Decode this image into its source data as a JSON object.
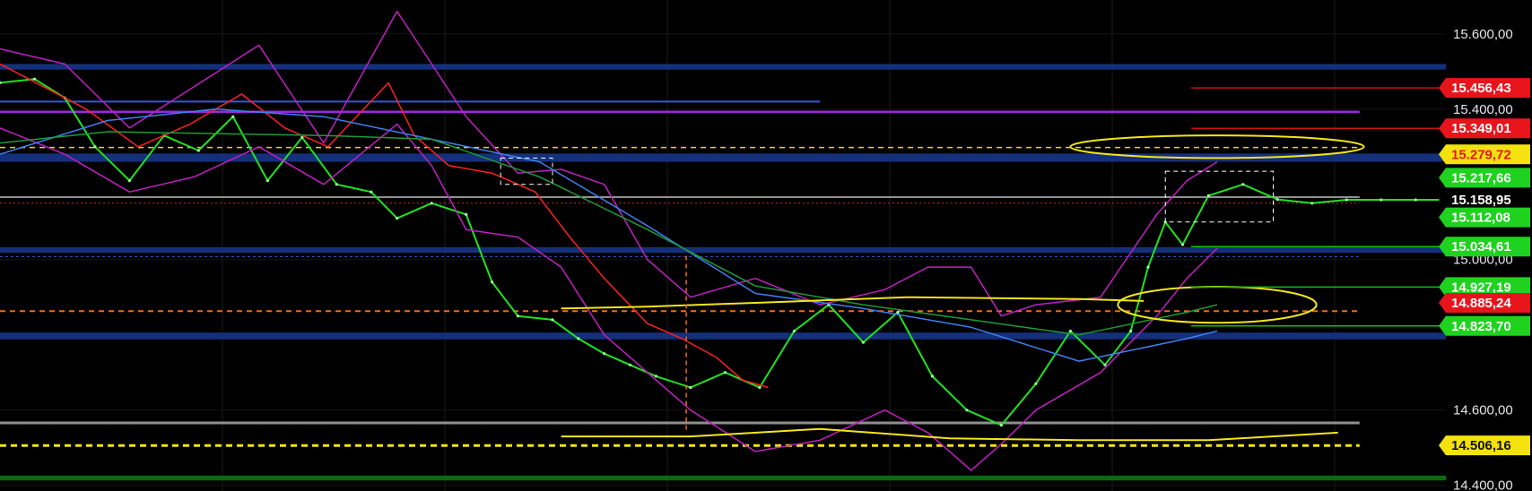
{
  "chart_data": {
    "type": "line",
    "ylim": [
      14385,
      15690
    ],
    "x_range": [
      0,
      335
    ],
    "grid": true,
    "y_axis_labels": [
      {
        "value": 15600,
        "text": "15.600,00"
      },
      {
        "value": 15400,
        "text": "15.400,00"
      },
      {
        "value": 15000,
        "text": "15.000,00"
      },
      {
        "value": 14600,
        "text": "14.600,00"
      },
      {
        "value": 14400,
        "text": "14.400,00"
      }
    ],
    "price_tags": [
      {
        "value": 15456.43,
        "text": "15.456,43",
        "bg": "#e8141c",
        "fg": "#ffffff",
        "line": "#d01010",
        "line_from": 276
      },
      {
        "value": 15349.01,
        "text": "15.349,01",
        "bg": "#e8141c",
        "fg": "#ffffff",
        "line": "#d01010",
        "line_from": 276
      },
      {
        "value": 15279.72,
        "text": "15.279,72",
        "bg": "#f4e20e",
        "fg": "#e8141c",
        "line": null,
        "line_from": null
      },
      {
        "value": 15217.66,
        "text": "15.217,66",
        "bg": "#1fd21f",
        "fg": "#ffffff",
        "line": null,
        "line_from": null
      },
      {
        "value": 15158.95,
        "text": "15.158,95",
        "bg": "#000000",
        "fg": "#ffffff",
        "line": null,
        "line_from": null
      },
      {
        "value": 15112.08,
        "text": "15.112,08",
        "bg": "#1fd21f",
        "fg": "#ffffff",
        "line": null,
        "line_from": null
      },
      {
        "value": 15034.61,
        "text": "15.034,61",
        "bg": "#1fd21f",
        "fg": "#ffffff",
        "line": "#10c010",
        "line_from": 276
      },
      {
        "value": 14927.19,
        "text": "14.927,19",
        "bg": "#1fd21f",
        "fg": "#ffffff",
        "line": "#10c010",
        "line_from": 276
      },
      {
        "value": 14885.24,
        "text": "14.885,24",
        "bg": "#e8141c",
        "fg": "#ffffff",
        "line": null,
        "line_from": null
      },
      {
        "value": 14823.7,
        "text": "14.823,70",
        "bg": "#1fd21f",
        "fg": "#ffffff",
        "line": "#10c010",
        "line_from": 276
      },
      {
        "value": 14506.16,
        "text": "14.506,16",
        "bg": "#f4e20e",
        "fg": "#111111",
        "line": null,
        "line_from": null
      }
    ],
    "zones": [
      {
        "from": 15505,
        "to": 15520,
        "color": "#15307a"
      },
      {
        "from": 15260,
        "to": 15282,
        "color": "#15307a"
      },
      {
        "from": 15018,
        "to": 15033,
        "color": "#15307a"
      },
      {
        "from": 14788,
        "to": 14806,
        "color": "#15307a"
      },
      {
        "from": 14413,
        "to": 14426,
        "color": "#0b6a10"
      }
    ],
    "levels": [
      {
        "value": 15420,
        "color": "#3a56d8",
        "width": 2,
        "dash": "",
        "x_end": 190
      },
      {
        "value": 15393,
        "color": "#9b28e0",
        "width": 2.5,
        "dash": "",
        "x_end": 315
      },
      {
        "value": 15298,
        "color": "#e6d820",
        "width": 1.5,
        "dash": "6,5",
        "x_end": 315
      },
      {
        "value": 15166,
        "color": "#bfbfbf",
        "width": 1.5,
        "dash": "",
        "x_end": 315
      },
      {
        "value": 15150,
        "color": "#cc2a2a",
        "width": 1,
        "dash": "2,3",
        "x_end": 315
      },
      {
        "value": 15008,
        "color": "#3a56d8",
        "width": 1,
        "dash": "3,3",
        "x_end": 315
      },
      {
        "value": 14863,
        "color": "#f06a1a",
        "width": 2,
        "dash": "6,5",
        "x_end": 315
      },
      {
        "value": 14566,
        "color": "#8f8f8f",
        "width": 3,
        "dash": "",
        "x_end": 315
      },
      {
        "value": 14506,
        "color": "#f4e20e",
        "width": 3,
        "dash": "7,5",
        "x_end": 315
      }
    ],
    "series": [
      {
        "role": "price",
        "color": "#1fe31f",
        "x": [
          0,
          8,
          15,
          22,
          30,
          38,
          46,
          54,
          62,
          70,
          78,
          86,
          92,
          100,
          108,
          114,
          120,
          128,
          134,
          140,
          146,
          152,
          160,
          168,
          176,
          184,
          192,
          200,
          208,
          216,
          224,
          232,
          240,
          248,
          256,
          262,
          266,
          270,
          274,
          280,
          288,
          296,
          304,
          312,
          320,
          328,
          335
        ],
        "values": [
          15470,
          15480,
          15430,
          15300,
          15210,
          15330,
          15290,
          15380,
          15210,
          15325,
          15200,
          15180,
          15110,
          15150,
          15120,
          14940,
          14850,
          14840,
          14790,
          14750,
          14720,
          14690,
          14660,
          14700,
          14660,
          14810,
          14880,
          14780,
          14860,
          14690,
          14600,
          14560,
          14670,
          14810,
          14720,
          14810,
          14980,
          15100,
          15040,
          15170,
          15200,
          15160,
          15150,
          15158.95,
          15158.95,
          15158.95,
          15158.95
        ]
      },
      {
        "role": "upper-band",
        "color": "#c21fc2",
        "x": [
          0,
          15,
          30,
          45,
          60,
          75,
          92,
          100,
          108,
          120,
          130,
          140,
          150,
          160,
          175,
          190,
          205,
          215,
          225,
          232,
          240,
          255,
          268,
          275,
          282
        ],
        "values": [
          15560,
          15520,
          15350,
          15460,
          15570,
          15310,
          15660,
          15520,
          15380,
          15230,
          15240,
          15200,
          15000,
          14900,
          14950,
          14880,
          14920,
          14980,
          14980,
          14850,
          14880,
          14900,
          15120,
          15210,
          15260
        ],
        "x_end": 282
      },
      {
        "role": "lower-band",
        "color": "#c21fc2",
        "x": [
          0,
          15,
          30,
          45,
          60,
          75,
          92,
          100,
          108,
          120,
          130,
          140,
          150,
          160,
          175,
          190,
          205,
          215,
          225,
          232,
          240,
          255,
          268,
          275,
          282
        ],
        "values": [
          15350,
          15280,
          15180,
          15220,
          15300,
          15200,
          15360,
          15250,
          15080,
          15060,
          14980,
          14800,
          14700,
          14600,
          14490,
          14520,
          14600,
          14540,
          14440,
          14510,
          14600,
          14700,
          14850,
          14950,
          15030
        ],
        "x_end": 282
      },
      {
        "role": "ma-red",
        "color": "#ff2020",
        "x": [
          0,
          10,
          20,
          32,
          44,
          56,
          66,
          76,
          90,
          96,
          104,
          114,
          124,
          132,
          140,
          150,
          158,
          166,
          172,
          178
        ],
        "values": [
          15520,
          15460,
          15400,
          15300,
          15360,
          15440,
          15350,
          15300,
          15470,
          15330,
          15250,
          15230,
          15180,
          15060,
          14950,
          14830,
          14790,
          14740,
          14680,
          14660
        ],
        "x_end": 178
      },
      {
        "role": "ma-blue",
        "color": "#3f7ff0",
        "x": [
          0,
          25,
          50,
          75,
          100,
          125,
          150,
          175,
          200,
          225,
          250,
          275,
          282
        ],
        "values": [
          15280,
          15370,
          15400,
          15380,
          15320,
          15260,
          15090,
          14910,
          14870,
          14820,
          14730,
          14790,
          14810
        ],
        "x_end": 282
      },
      {
        "role": "ma-dark-green",
        "color": "#1f9a3a",
        "x": [
          0,
          25,
          50,
          75,
          100,
          125,
          150,
          175,
          200,
          225,
          250,
          275,
          282
        ],
        "values": [
          15310,
          15340,
          15335,
          15330,
          15320,
          15220,
          15080,
          14930,
          14880,
          14840,
          14800,
          14860,
          14880
        ],
        "x_end": 282
      }
    ],
    "annotations": [
      {
        "kind": "curve",
        "color": "#f2e61c",
        "points": [
          [
            130,
            14870
          ],
          [
            150,
            14875
          ],
          [
            175,
            14885
          ],
          [
            210,
            14900
          ],
          [
            250,
            14895
          ],
          [
            265,
            14890
          ]
        ]
      },
      {
        "kind": "curve",
        "color": "#f2e61c",
        "points": [
          [
            130,
            14530
          ],
          [
            160,
            14530
          ],
          [
            190,
            14550
          ],
          [
            220,
            14525
          ],
          [
            250,
            14520
          ],
          [
            280,
            14520
          ],
          [
            310,
            14540
          ]
        ]
      },
      {
        "kind": "ellipse",
        "color": "#f2e61c",
        "cx": 282,
        "cy": 15300,
        "rx": 34,
        "ry": 30
      },
      {
        "kind": "ellipse",
        "color": "#f2e61c",
        "cx": 282,
        "cy": 14880,
        "rx": 23,
        "ry": 48
      },
      {
        "kind": "rect",
        "color": "#ffffff",
        "x0": 116,
        "x1": 128,
        "y0": 15270,
        "y1": 15200
      },
      {
        "kind": "rect",
        "color": "#ffffff",
        "x0": 270,
        "x1": 295,
        "y0": 15235,
        "y1": 15100
      },
      {
        "kind": "vline",
        "color": "#f06a1a",
        "x": 159,
        "y0": 15010,
        "y1": 14540
      }
    ]
  }
}
